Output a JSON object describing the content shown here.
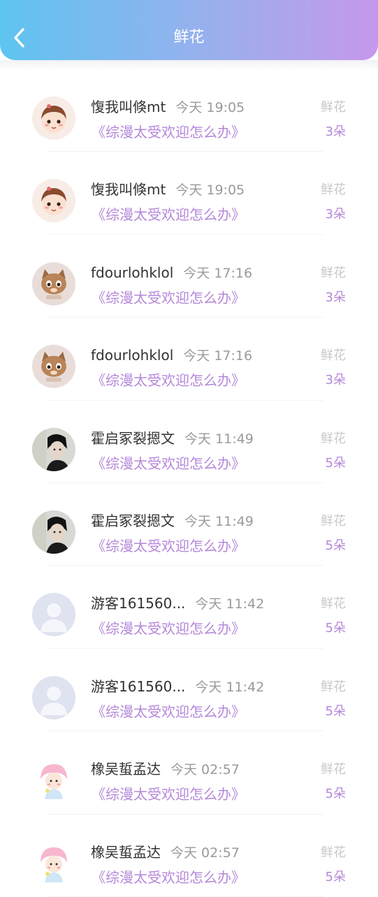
{
  "header": {
    "title": "鲜花",
    "back_icon": "chevron-left-icon",
    "gradient": [
      "#5ec4f0",
      "#c698ec"
    ]
  },
  "colors": {
    "accent": "#b487d9",
    "muted": "#9a9a9a"
  },
  "items": [
    {
      "name": "愎我叫倏mt",
      "time": "今天 19:05",
      "book": "《综漫太受欢迎怎么办》",
      "gift": "鲜花",
      "amount": "3朵",
      "avatar": "cartoon-girl-avatar"
    },
    {
      "name": "愎我叫倏mt",
      "time": "今天 19:05",
      "book": "《综漫太受欢迎怎么办》",
      "gift": "鲜花",
      "amount": "3朵",
      "avatar": "cartoon-girl-avatar"
    },
    {
      "name": "fdourlohklol",
      "time": "今天 17:16",
      "book": "《综漫太受欢迎怎么办》",
      "gift": "鲜花",
      "amount": "3朵",
      "avatar": "anime-cat-avatar"
    },
    {
      "name": "fdourlohklol",
      "time": "今天 17:16",
      "book": "《综漫太受欢迎怎么办》",
      "gift": "鲜花",
      "amount": "3朵",
      "avatar": "anime-cat-avatar"
    },
    {
      "name": "霍启冢裂摁文",
      "time": "今天 11:49",
      "book": "《综漫太受欢迎怎么办》",
      "gift": "鲜花",
      "amount": "5朵",
      "avatar": "photo-person-avatar"
    },
    {
      "name": "霍启冢裂摁文",
      "time": "今天 11:49",
      "book": "《综漫太受欢迎怎么办》",
      "gift": "鲜花",
      "amount": "5朵",
      "avatar": "photo-person-avatar"
    },
    {
      "name": "游客161560...",
      "time": "今天 11:42",
      "book": "《综漫太受欢迎怎么办》",
      "gift": "鲜花",
      "amount": "5朵",
      "avatar": "default-user-avatar"
    },
    {
      "name": "游客161560...",
      "time": "今天 11:42",
      "book": "《综漫太受欢迎怎么办》",
      "gift": "鲜花",
      "amount": "5朵",
      "avatar": "default-user-avatar"
    },
    {
      "name": "橡吴蜇孟达",
      "time": "今天 02:57",
      "book": "《综漫太受欢迎怎么办》",
      "gift": "鲜花",
      "amount": "5朵",
      "avatar": "cartoon-pink-avatar"
    },
    {
      "name": "橡吴蜇孟达",
      "time": "今天 02:57",
      "book": "《综漫太受欢迎怎么办》",
      "gift": "鲜花",
      "amount": "5朵",
      "avatar": "cartoon-pink-avatar"
    }
  ]
}
